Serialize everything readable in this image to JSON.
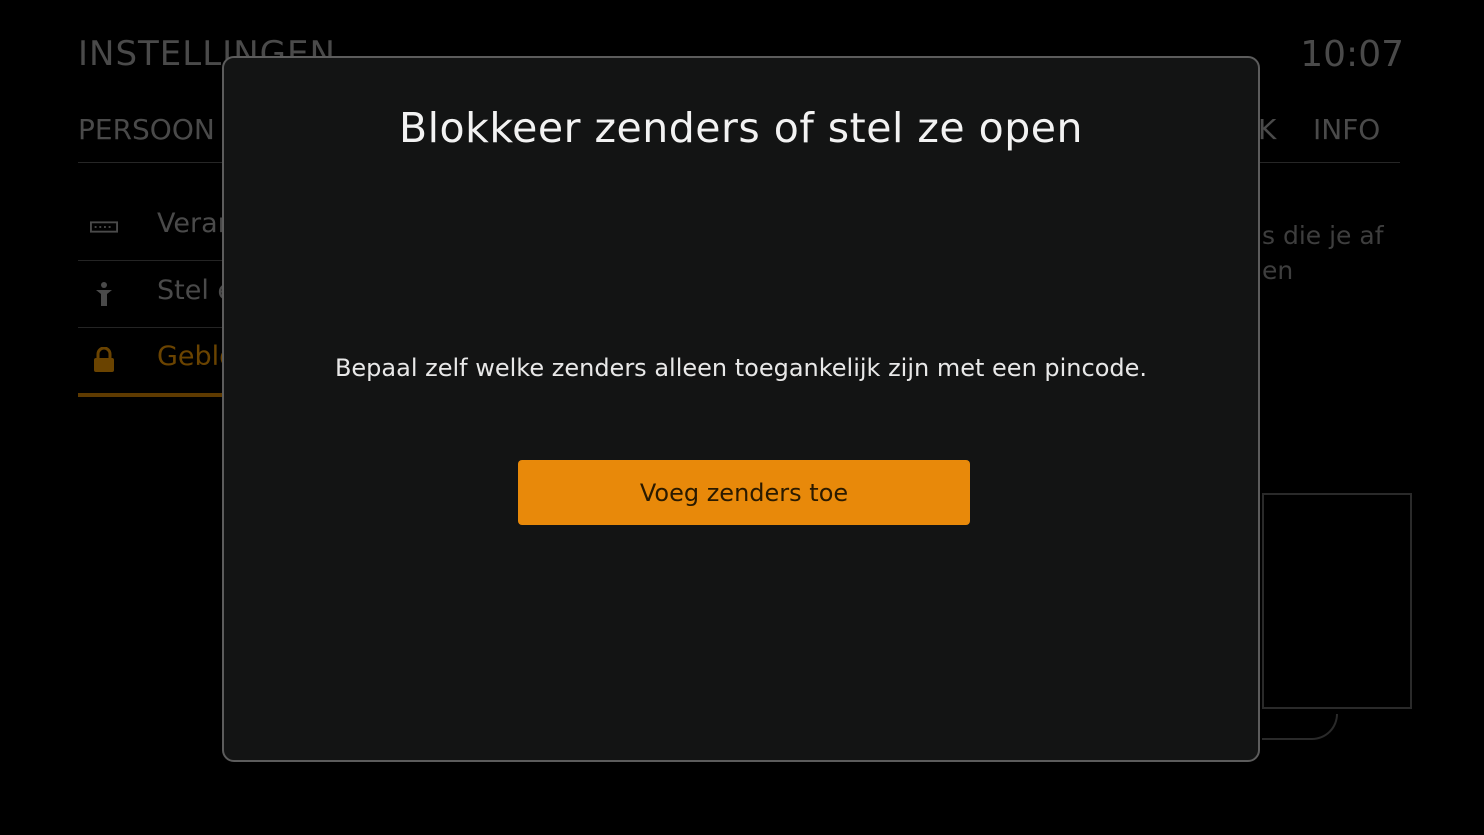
{
  "background": {
    "title": "INSTELLINGEN",
    "subtitle": "",
    "clock": "10:07",
    "tabs": [
      {
        "label": "PERSOON"
      },
      {
        "label": "K"
      },
      {
        "label": "INFO"
      }
    ],
    "menu_items": [
      {
        "label": "Verar",
        "icon": "keyboard-icon"
      },
      {
        "label": "Stel e",
        "icon": "person-icon"
      },
      {
        "label": "Geblo",
        "icon": "lock-icon",
        "active": true
      }
    ],
    "description": "s die je af\nen"
  },
  "modal": {
    "title": "Blokkeer zenders of stel ze open",
    "body": "Bepaal zelf welke zenders alleen toegankelijk zijn met een pincode.",
    "button_label": "Voeg zenders toe"
  },
  "colors": {
    "accent": "#e8890a",
    "modal_bg": "#131414",
    "modal_border": "#5c5c5c"
  }
}
